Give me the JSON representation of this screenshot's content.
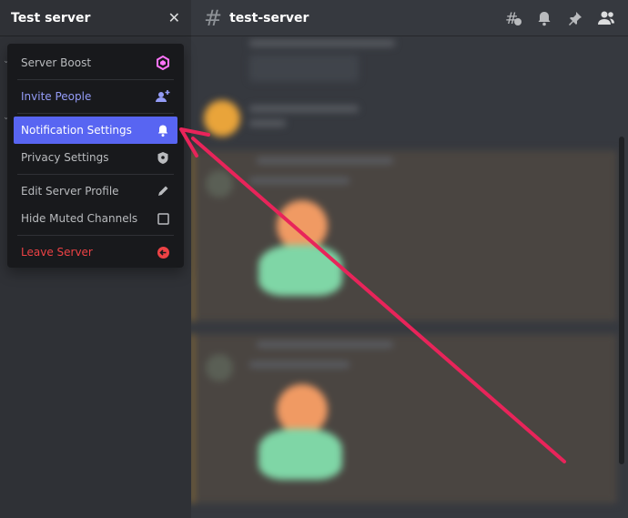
{
  "sidebar": {
    "server_title": "Test server",
    "close_icon": "close-icon"
  },
  "menu": {
    "items": [
      {
        "label": "Server Boost",
        "icon": "boost-icon"
      },
      {
        "label": "Invite People",
        "icon": "add-user-icon"
      },
      {
        "label": "Notification Settings",
        "icon": "bell-icon"
      },
      {
        "label": "Privacy Settings",
        "icon": "shield-icon"
      },
      {
        "label": "Edit Server Profile",
        "icon": "pencil-icon"
      },
      {
        "label": "Hide Muted Channels",
        "icon": "checkbox-icon"
      },
      {
        "label": "Leave Server",
        "icon": "leave-icon"
      }
    ]
  },
  "header": {
    "channel_name": "test-server",
    "icons": [
      "threads-icon",
      "bell-icon",
      "pin-icon",
      "members-icon"
    ]
  },
  "colors": {
    "accent": "#5865f2",
    "invite": "#949cf7",
    "danger": "#ed4245",
    "boost": "#ff73fa",
    "arrow": "#e8245a"
  }
}
